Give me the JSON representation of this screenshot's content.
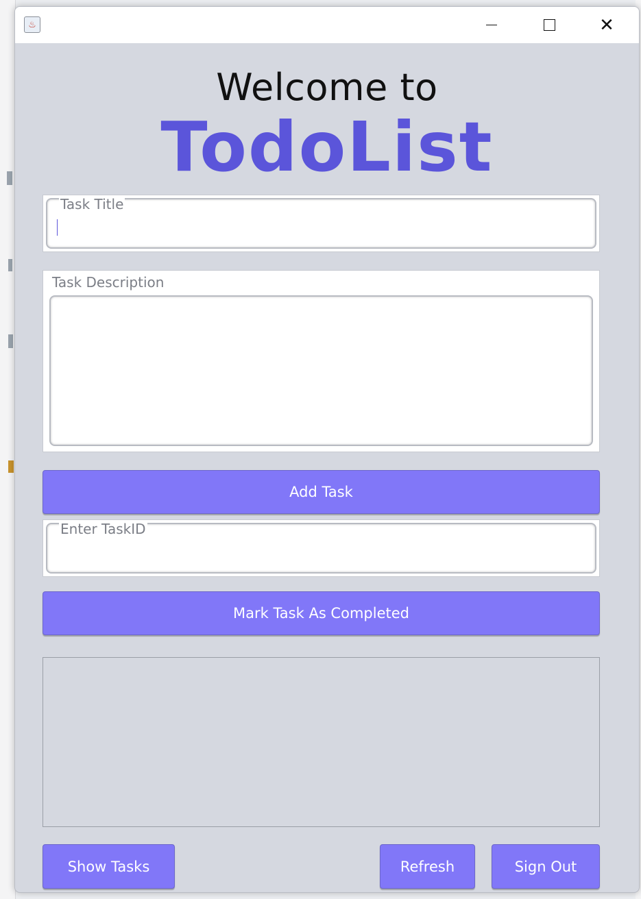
{
  "window": {
    "title_icon": "java-app-icon",
    "controls": {
      "minimize": "minimize-icon",
      "maximize": "maximize-icon",
      "close": "close-icon",
      "close_glyph": "✕"
    }
  },
  "header": {
    "welcome": "Welcome to",
    "brand": "TodoList",
    "brand_color": "#5b55da"
  },
  "form": {
    "task_title_label": "Task Title",
    "task_title_value": "",
    "task_description_label": "Task Description",
    "task_description_value": "",
    "add_task_label": "Add Task",
    "task_id_label": "Enter TaskID",
    "task_id_value": "",
    "mark_completed_label": "Mark Task As Completed"
  },
  "footer": {
    "show_tasks_label": "Show Tasks",
    "refresh_label": "Refresh",
    "sign_out_label": "Sign Out"
  },
  "colors": {
    "button_bg": "#8177f8",
    "window_bg": "#d5d8e0"
  }
}
